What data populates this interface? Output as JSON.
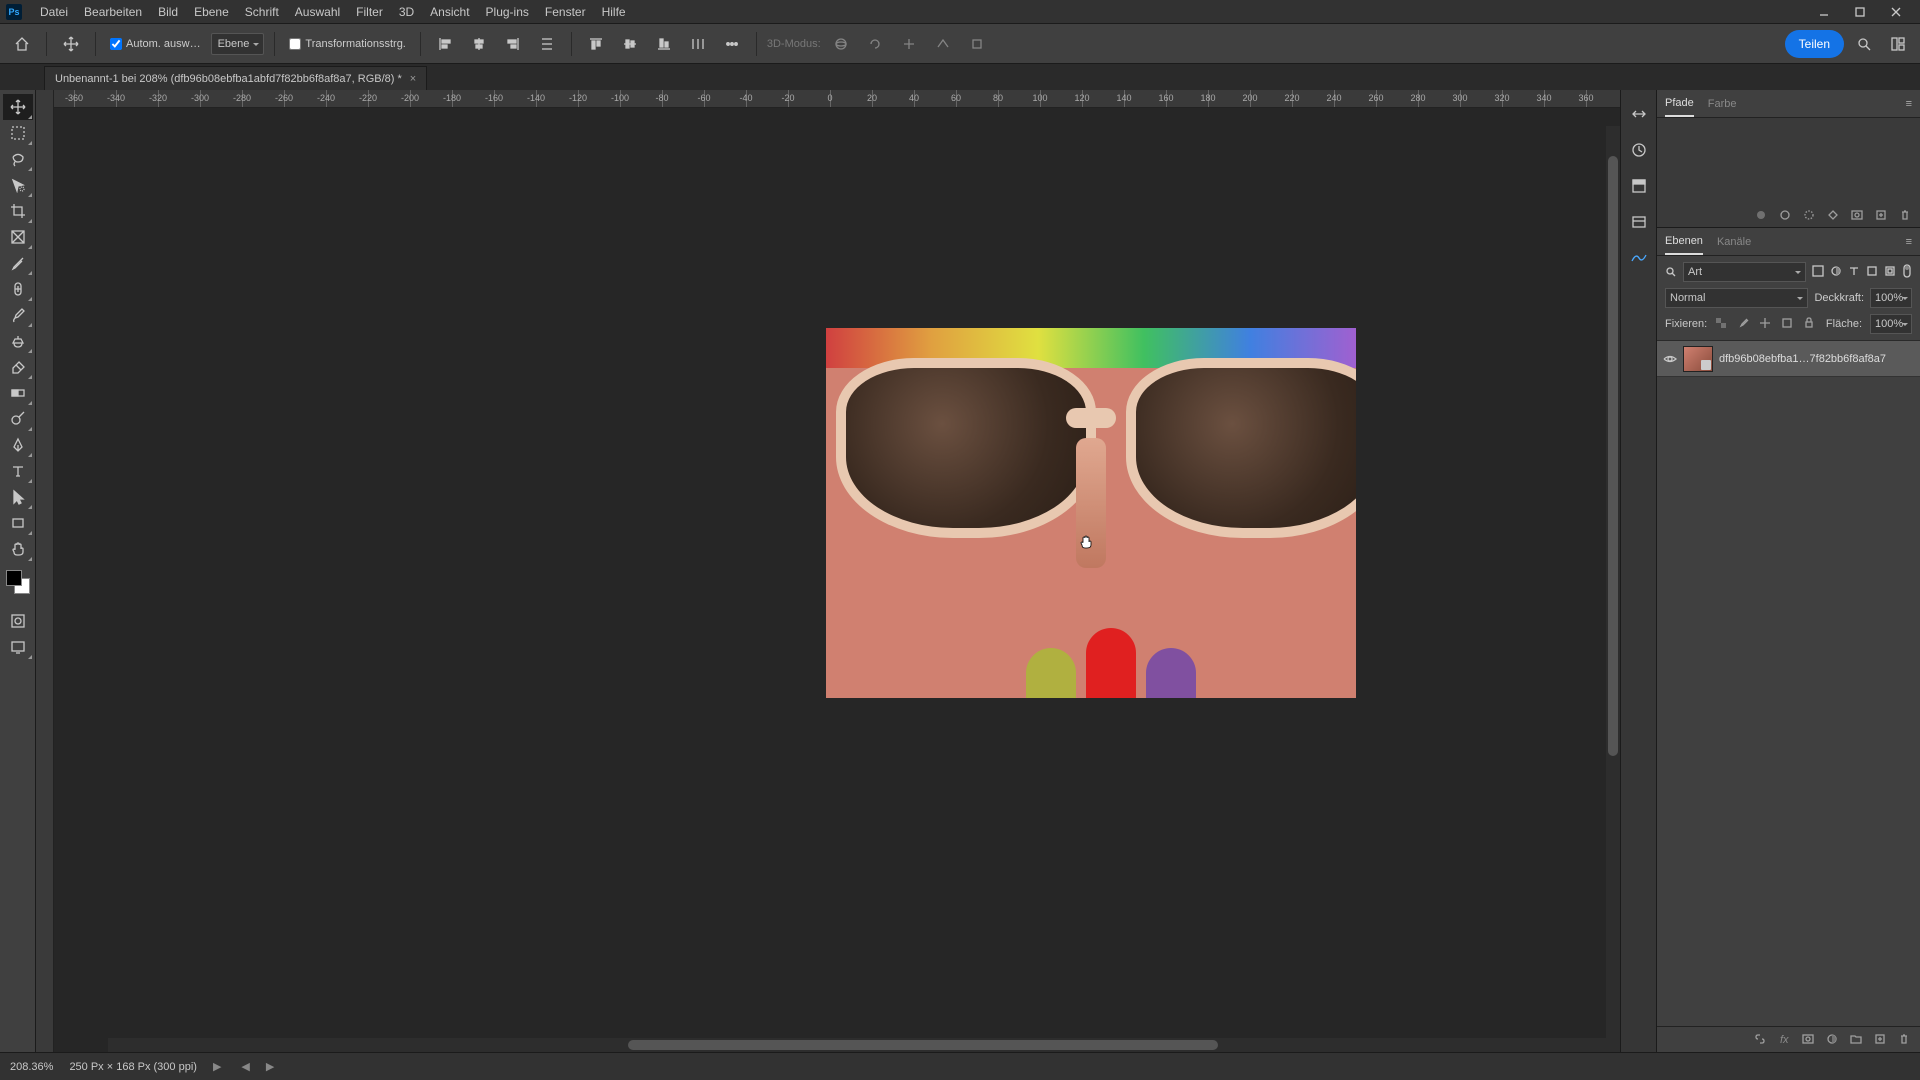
{
  "menu": {
    "items": [
      "Datei",
      "Bearbeiten",
      "Bild",
      "Ebene",
      "Schrift",
      "Auswahl",
      "Filter",
      "3D",
      "Ansicht",
      "Plug-ins",
      "Fenster",
      "Hilfe"
    ]
  },
  "logo": "Ps",
  "optionsBar": {
    "autoSelectLabel": "Autom. ausw…",
    "layerSelect": "Ebene",
    "transformLabel": "Transformationsstrg.",
    "threeDLabel": "3D-Modus:",
    "shareLabel": "Teilen"
  },
  "docTab": {
    "title": "Unbenannt-1 bei 208% (dfb96b08ebfba1abfd7f82bb6f8af8a7, RGB/8) *"
  },
  "rulerH": [
    "-360",
    "-340",
    "-320",
    "-300",
    "-280",
    "-260",
    "-240",
    "-220",
    "-200",
    "-180",
    "-160",
    "-140",
    "-120",
    "-100",
    "-80",
    "-60",
    "-40",
    "-20",
    "0",
    "20",
    "40",
    "60",
    "80",
    "100",
    "120",
    "140",
    "160",
    "180",
    "200",
    "220",
    "240",
    "260",
    "280",
    "300",
    "320",
    "340",
    "360"
  ],
  "panels": {
    "paths": {
      "tabs": [
        "Pfade",
        "Farbe"
      ]
    },
    "layers": {
      "tabs": [
        "Ebenen",
        "Kanäle"
      ],
      "searchLabel": "Art",
      "blendMode": "Normal",
      "opacityLabel": "Deckkraft:",
      "opacityValue": "100%",
      "lockLabel": "Fixieren:",
      "fillLabel": "Fläche:",
      "fillValue": "100%",
      "layer1Name": "dfb96b08ebfba1…7f82bb6f8af8a7"
    }
  },
  "status": {
    "zoom": "208.36%",
    "docinfo": "250 Px × 168 Px (300 ppi)"
  }
}
